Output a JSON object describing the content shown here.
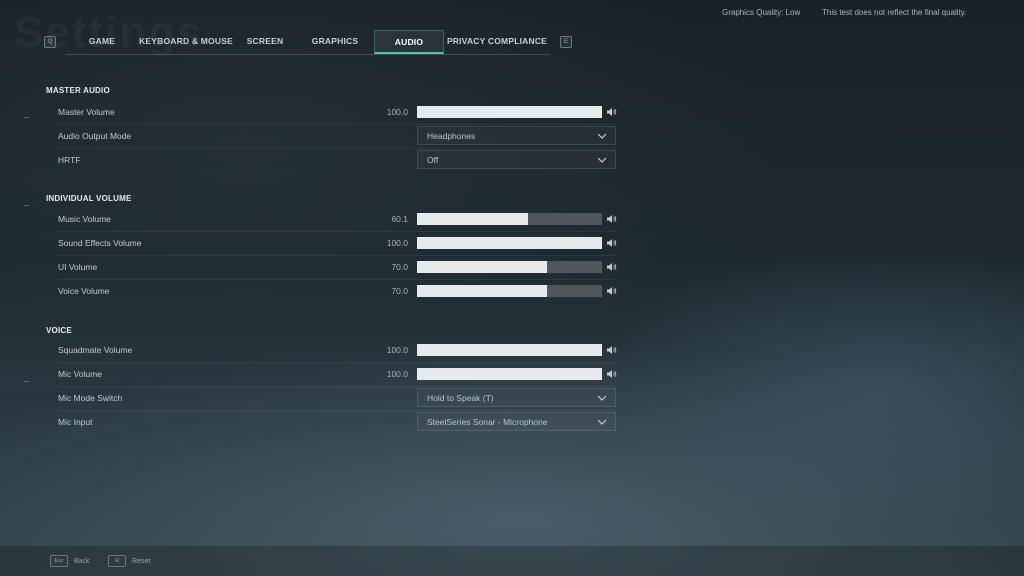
{
  "ghost_title": "Settings",
  "top_info": {
    "graphics_quality": "Graphics Quality: Low",
    "disclaimer": "This test does not reflect the final quality."
  },
  "nav": {
    "prev_key": "Q",
    "next_key": "E",
    "tabs": [
      {
        "label": "GAME",
        "active": false
      },
      {
        "label": "KEYBOARD & MOUSE",
        "active": false
      },
      {
        "label": "SCREEN",
        "active": false
      },
      {
        "label": "GRAPHICS",
        "active": false
      },
      {
        "label": "AUDIO",
        "active": true
      },
      {
        "label": "PRIVACY COMPLIANCE",
        "active": false
      }
    ]
  },
  "sections": {
    "master": {
      "title": "MASTER AUDIO",
      "master_volume": {
        "label": "Master Volume",
        "value": "100.0",
        "level": 1.0
      },
      "output_mode": {
        "label": "Audio Output Mode",
        "value": "Headphones"
      },
      "hrtf": {
        "label": "HRTF",
        "value": "Off"
      }
    },
    "individual": {
      "title": "INDIVIDUAL VOLUME",
      "music": {
        "label": "Music Volume",
        "value": "60.1",
        "level": 0.601
      },
      "sfx": {
        "label": "Sound Effects Volume",
        "value": "100.0",
        "level": 1.0
      },
      "ui": {
        "label": "UI Volume",
        "value": "70.0",
        "level": 0.7
      },
      "voice": {
        "label": "Voice Volume",
        "value": "70.0",
        "level": 0.7
      }
    },
    "voice": {
      "title": "VOICE",
      "squadmate": {
        "label": "Squadmate Volume",
        "value": "100.0",
        "level": 1.0
      },
      "mic_volume": {
        "label": "Mic Volume",
        "value": "100.0",
        "level": 1.0
      },
      "mic_mode": {
        "label": "Mic Mode Switch",
        "value": "Hold to Speak (T)"
      },
      "mic_input": {
        "label": "Mic Input",
        "value": "SteelSeries Sonar - Microphone"
      }
    }
  },
  "footer": {
    "back_key": "Esc",
    "back_label": "Back",
    "reset_key": "R",
    "reset_label": "Reset"
  },
  "icons": {
    "speaker": "speaker-icon",
    "chevron": "chevron-down-icon"
  },
  "colors": {
    "accent": "#3fcf9a",
    "slider_fill": "#e7e9ea",
    "slider_track": "#50585c"
  }
}
